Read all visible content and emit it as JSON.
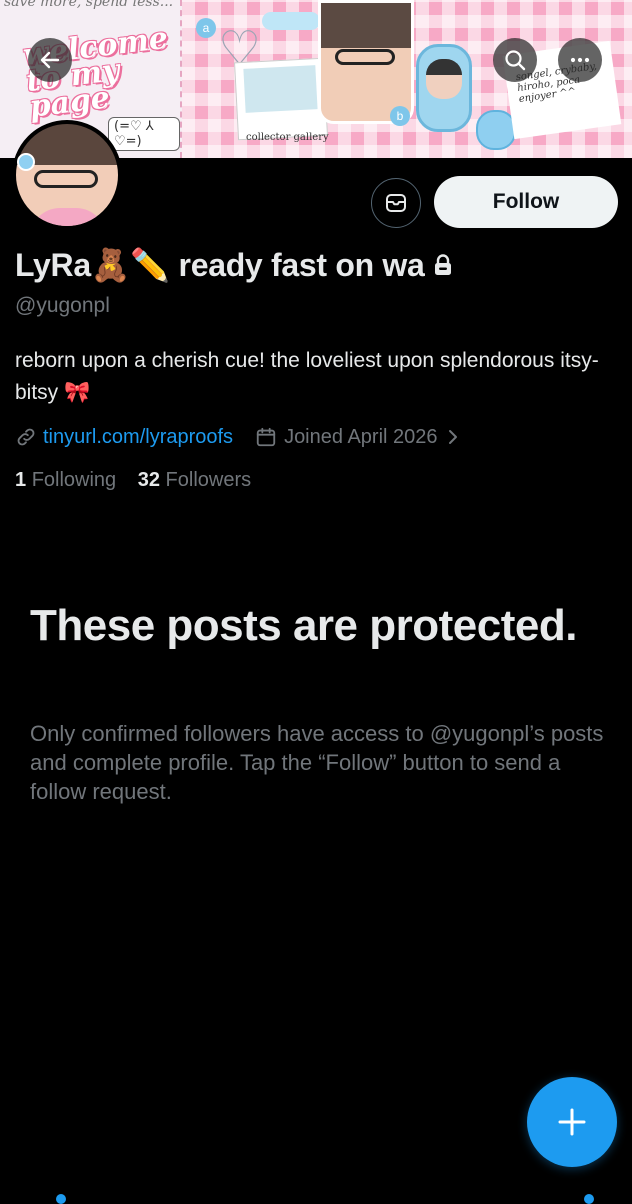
{
  "banner": {
    "top_text": "save more, spend less...",
    "title": "welcome to my page",
    "kaomoji": "(=♡ ⅄ ♡=)",
    "caption": "collector gallery",
    "note": "songel, crybaby, hiroho, poca enjoyer ^^",
    "badge_a": "a",
    "badge_b": "b"
  },
  "nav": {
    "back_icon": "arrow-left-icon",
    "search_icon": "search-icon",
    "more_icon": "more-dots-icon"
  },
  "profile": {
    "name": "LyRa🧸✏️ ready fast on wa",
    "lock_icon": "lock-icon",
    "handle": "@yugonpl",
    "bio": "reborn upon a cherish cue! the loveliest upon splendorous itsy-bitsy 🎀",
    "link_icon": "link-icon",
    "link": "tinyurl.com/lyraproofs",
    "calendar_icon": "calendar-icon",
    "joined": "Joined April 2026",
    "following_count": "1",
    "following_label": "Following",
    "followers_count": "32",
    "followers_label": "Followers"
  },
  "actions": {
    "message_icon": "message-icon",
    "follow_label": "Follow"
  },
  "protected": {
    "title": "These posts are protected.",
    "text": "Only confirmed followers have access to @yugonpl’s posts and complete profile. Tap the “Follow” button to send a follow request."
  },
  "fab": {
    "icon": "plus-icon"
  },
  "colors": {
    "background": "#000000",
    "primary_text": "#e7e9ea",
    "secondary_text": "#71767b",
    "accent": "#1d9bf0",
    "follow_button": "#eff3f4",
    "banner_pink": "#f7a9c6"
  }
}
